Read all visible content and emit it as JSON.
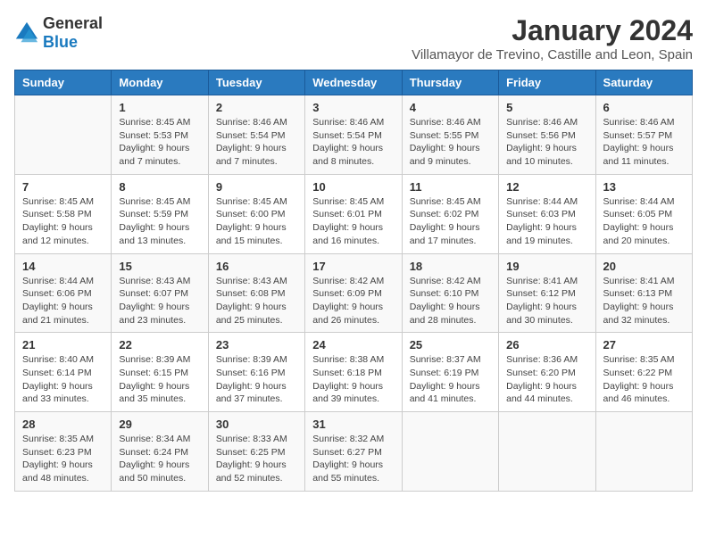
{
  "logo": {
    "general": "General",
    "blue": "Blue"
  },
  "title": "January 2024",
  "subtitle": "Villamayor de Trevino, Castille and Leon, Spain",
  "weekdays": [
    "Sunday",
    "Monday",
    "Tuesday",
    "Wednesday",
    "Thursday",
    "Friday",
    "Saturday"
  ],
  "weeks": [
    [
      {
        "date": "",
        "sunrise": "",
        "sunset": "",
        "daylight": ""
      },
      {
        "date": "1",
        "sunrise": "Sunrise: 8:45 AM",
        "sunset": "Sunset: 5:53 PM",
        "daylight": "Daylight: 9 hours and 7 minutes."
      },
      {
        "date": "2",
        "sunrise": "Sunrise: 8:46 AM",
        "sunset": "Sunset: 5:54 PM",
        "daylight": "Daylight: 9 hours and 7 minutes."
      },
      {
        "date": "3",
        "sunrise": "Sunrise: 8:46 AM",
        "sunset": "Sunset: 5:54 PM",
        "daylight": "Daylight: 9 hours and 8 minutes."
      },
      {
        "date": "4",
        "sunrise": "Sunrise: 8:46 AM",
        "sunset": "Sunset: 5:55 PM",
        "daylight": "Daylight: 9 hours and 9 minutes."
      },
      {
        "date": "5",
        "sunrise": "Sunrise: 8:46 AM",
        "sunset": "Sunset: 5:56 PM",
        "daylight": "Daylight: 9 hours and 10 minutes."
      },
      {
        "date": "6",
        "sunrise": "Sunrise: 8:46 AM",
        "sunset": "Sunset: 5:57 PM",
        "daylight": "Daylight: 9 hours and 11 minutes."
      }
    ],
    [
      {
        "date": "7",
        "sunrise": "Sunrise: 8:45 AM",
        "sunset": "Sunset: 5:58 PM",
        "daylight": "Daylight: 9 hours and 12 minutes."
      },
      {
        "date": "8",
        "sunrise": "Sunrise: 8:45 AM",
        "sunset": "Sunset: 5:59 PM",
        "daylight": "Daylight: 9 hours and 13 minutes."
      },
      {
        "date": "9",
        "sunrise": "Sunrise: 8:45 AM",
        "sunset": "Sunset: 6:00 PM",
        "daylight": "Daylight: 9 hours and 15 minutes."
      },
      {
        "date": "10",
        "sunrise": "Sunrise: 8:45 AM",
        "sunset": "Sunset: 6:01 PM",
        "daylight": "Daylight: 9 hours and 16 minutes."
      },
      {
        "date": "11",
        "sunrise": "Sunrise: 8:45 AM",
        "sunset": "Sunset: 6:02 PM",
        "daylight": "Daylight: 9 hours and 17 minutes."
      },
      {
        "date": "12",
        "sunrise": "Sunrise: 8:44 AM",
        "sunset": "Sunset: 6:03 PM",
        "daylight": "Daylight: 9 hours and 19 minutes."
      },
      {
        "date": "13",
        "sunrise": "Sunrise: 8:44 AM",
        "sunset": "Sunset: 6:05 PM",
        "daylight": "Daylight: 9 hours and 20 minutes."
      }
    ],
    [
      {
        "date": "14",
        "sunrise": "Sunrise: 8:44 AM",
        "sunset": "Sunset: 6:06 PM",
        "daylight": "Daylight: 9 hours and 21 minutes."
      },
      {
        "date": "15",
        "sunrise": "Sunrise: 8:43 AM",
        "sunset": "Sunset: 6:07 PM",
        "daylight": "Daylight: 9 hours and 23 minutes."
      },
      {
        "date": "16",
        "sunrise": "Sunrise: 8:43 AM",
        "sunset": "Sunset: 6:08 PM",
        "daylight": "Daylight: 9 hours and 25 minutes."
      },
      {
        "date": "17",
        "sunrise": "Sunrise: 8:42 AM",
        "sunset": "Sunset: 6:09 PM",
        "daylight": "Daylight: 9 hours and 26 minutes."
      },
      {
        "date": "18",
        "sunrise": "Sunrise: 8:42 AM",
        "sunset": "Sunset: 6:10 PM",
        "daylight": "Daylight: 9 hours and 28 minutes."
      },
      {
        "date": "19",
        "sunrise": "Sunrise: 8:41 AM",
        "sunset": "Sunset: 6:12 PM",
        "daylight": "Daylight: 9 hours and 30 minutes."
      },
      {
        "date": "20",
        "sunrise": "Sunrise: 8:41 AM",
        "sunset": "Sunset: 6:13 PM",
        "daylight": "Daylight: 9 hours and 32 minutes."
      }
    ],
    [
      {
        "date": "21",
        "sunrise": "Sunrise: 8:40 AM",
        "sunset": "Sunset: 6:14 PM",
        "daylight": "Daylight: 9 hours and 33 minutes."
      },
      {
        "date": "22",
        "sunrise": "Sunrise: 8:39 AM",
        "sunset": "Sunset: 6:15 PM",
        "daylight": "Daylight: 9 hours and 35 minutes."
      },
      {
        "date": "23",
        "sunrise": "Sunrise: 8:39 AM",
        "sunset": "Sunset: 6:16 PM",
        "daylight": "Daylight: 9 hours and 37 minutes."
      },
      {
        "date": "24",
        "sunrise": "Sunrise: 8:38 AM",
        "sunset": "Sunset: 6:18 PM",
        "daylight": "Daylight: 9 hours and 39 minutes."
      },
      {
        "date": "25",
        "sunrise": "Sunrise: 8:37 AM",
        "sunset": "Sunset: 6:19 PM",
        "daylight": "Daylight: 9 hours and 41 minutes."
      },
      {
        "date": "26",
        "sunrise": "Sunrise: 8:36 AM",
        "sunset": "Sunset: 6:20 PM",
        "daylight": "Daylight: 9 hours and 44 minutes."
      },
      {
        "date": "27",
        "sunrise": "Sunrise: 8:35 AM",
        "sunset": "Sunset: 6:22 PM",
        "daylight": "Daylight: 9 hours and 46 minutes."
      }
    ],
    [
      {
        "date": "28",
        "sunrise": "Sunrise: 8:35 AM",
        "sunset": "Sunset: 6:23 PM",
        "daylight": "Daylight: 9 hours and 48 minutes."
      },
      {
        "date": "29",
        "sunrise": "Sunrise: 8:34 AM",
        "sunset": "Sunset: 6:24 PM",
        "daylight": "Daylight: 9 hours and 50 minutes."
      },
      {
        "date": "30",
        "sunrise": "Sunrise: 8:33 AM",
        "sunset": "Sunset: 6:25 PM",
        "daylight": "Daylight: 9 hours and 52 minutes."
      },
      {
        "date": "31",
        "sunrise": "Sunrise: 8:32 AM",
        "sunset": "Sunset: 6:27 PM",
        "daylight": "Daylight: 9 hours and 55 minutes."
      },
      {
        "date": "",
        "sunrise": "",
        "sunset": "",
        "daylight": ""
      },
      {
        "date": "",
        "sunrise": "",
        "sunset": "",
        "daylight": ""
      },
      {
        "date": "",
        "sunrise": "",
        "sunset": "",
        "daylight": ""
      }
    ]
  ]
}
